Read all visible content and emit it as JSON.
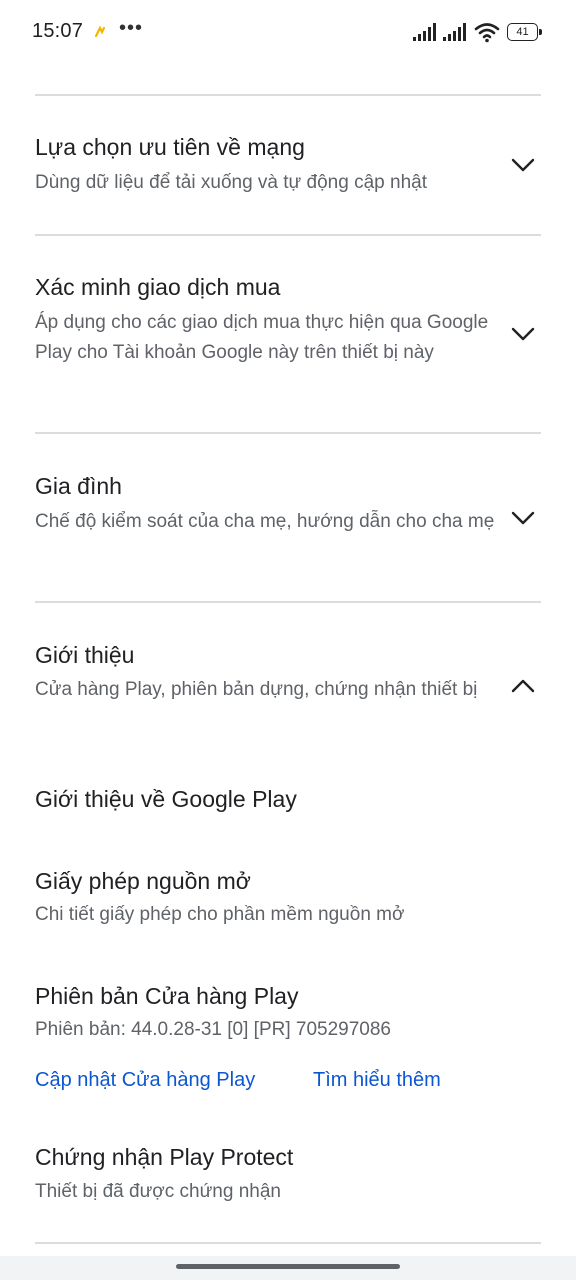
{
  "status_bar": {
    "time": "15:07",
    "battery": "41",
    "icons": [
      "notification-icon",
      "more-icon",
      "signal-icon",
      "signal-icon",
      "wifi-icon",
      "battery-icon"
    ]
  },
  "sections": [
    {
      "title": "Lựa chọn ưu tiên về mạng",
      "subtitle": "Dùng dữ liệu để tải xuống và tự động cập nhật",
      "expanded": false
    },
    {
      "title": "Xác minh giao dịch mua",
      "subtitle": "Áp dụng cho các giao dịch mua thực hiện qua Google Play cho Tài khoản Google này trên thiết bị này",
      "expanded": false
    },
    {
      "title": "Gia đình",
      "subtitle": "Chế độ kiểm soát của cha mẹ, hướng dẫn cho cha mẹ",
      "expanded": false
    },
    {
      "title": "Giới thiệu",
      "subtitle": "Cửa hàng Play, phiên bản dựng, chứng nhận thiết bị",
      "expanded": true
    }
  ],
  "about": {
    "about_google_play": "Giới thiệu về Google Play",
    "licenses_title": "Giấy phép nguồn mở",
    "licenses_sub": "Chi tiết giấy phép cho phần mềm nguồn mở",
    "version_title": "Phiên bản Cửa hàng Play",
    "version_sub": "Phiên bản: 44.0.28-31 [0] [PR] 705297086",
    "update_link": "Cập nhật Cửa hàng Play",
    "learn_more_link": "Tìm hiểu thêm",
    "protect_title": "Chứng nhận Play Protect",
    "protect_sub": "Thiết bị đã được chứng nhận"
  },
  "colors": {
    "link": "#0b57d0",
    "divider": "#dadce0",
    "primary_text": "#202124",
    "secondary_text": "#5f6368"
  }
}
